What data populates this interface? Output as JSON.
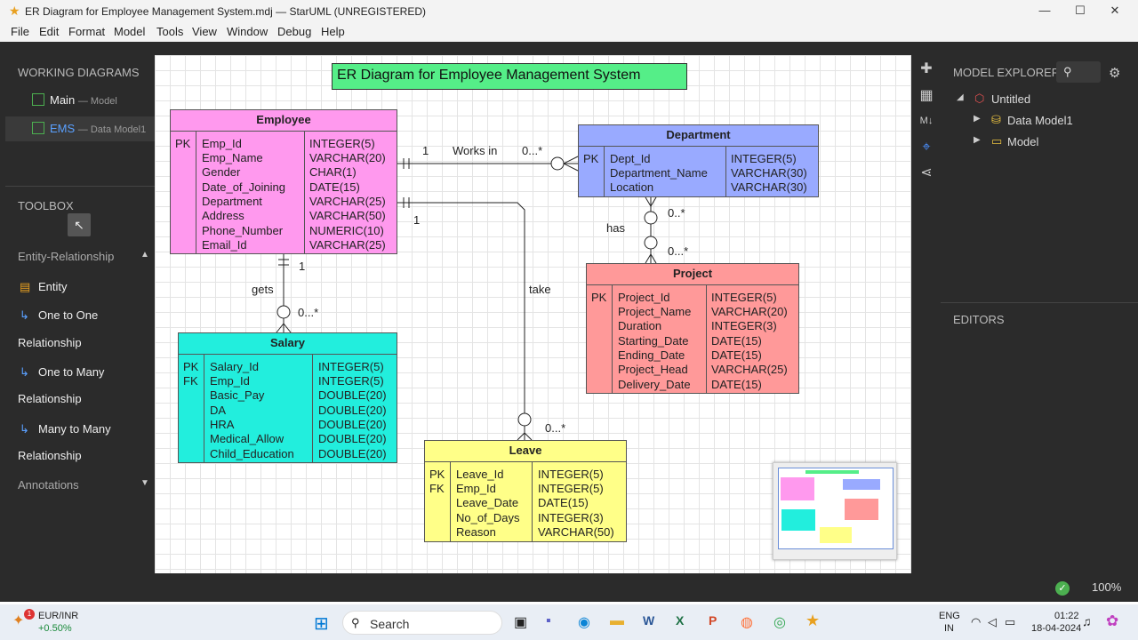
{
  "window": {
    "title": "ER Diagram for Employee Management System.mdj — StarUML (UNREGISTERED)",
    "minimize": "—",
    "maximize": "☐",
    "close": "✕"
  },
  "menu": [
    "File",
    "Edit",
    "Format",
    "Model",
    "Tools",
    "View",
    "Window",
    "Debug",
    "Help"
  ],
  "left_panel": {
    "working_diagrams_title": "WORKING DIAGRAMS",
    "diagrams": [
      {
        "name": "Main",
        "sub": "— Model"
      },
      {
        "name": "EMS",
        "sub": "— Data Model1"
      }
    ],
    "toolbox_title": "TOOLBOX",
    "section": "Entity-Relationship",
    "tools": [
      "Entity",
      "One to One",
      "Relationship",
      "One to Many",
      "Relationship",
      "Many to Many",
      "Relationship"
    ],
    "annotations": "Annotations"
  },
  "right_panel": {
    "model_explorer": "MODEL EXPLORER",
    "tree": [
      "Untitled",
      "Data Model1",
      "Model"
    ],
    "editors": "EDITORS"
  },
  "diagram": {
    "title": "ER Diagram for Employee Management System",
    "employee": {
      "name": "Employee",
      "keys": [
        "PK"
      ],
      "fields": [
        "Emp_Id",
        "Emp_Name",
        "Gender",
        "Date_of_Joining",
        "Department",
        "Address",
        "Phone_Number",
        "Email_Id"
      ],
      "types": [
        "INTEGER(5)",
        "VARCHAR(20)",
        "CHAR(1)",
        "DATE(15)",
        "VARCHAR(25)",
        "VARCHAR(50)",
        "NUMERIC(10)",
        "VARCHAR(25)"
      ]
    },
    "department": {
      "name": "Department",
      "keys": [
        "PK"
      ],
      "fields": [
        "Dept_Id",
        "Department_Name",
        "Location"
      ],
      "types": [
        "INTEGER(5)",
        "VARCHAR(30)",
        "VARCHAR(30)"
      ]
    },
    "project": {
      "name": "Project",
      "keys": [
        "PK"
      ],
      "fields": [
        "Project_Id",
        "Project_Name",
        "Duration",
        "Starting_Date",
        "Ending_Date",
        "Project_Head",
        "Delivery_Date"
      ],
      "types": [
        "INTEGER(5)",
        "VARCHAR(20)",
        "INTEGER(3)",
        "DATE(15)",
        "DATE(15)",
        "VARCHAR(25)",
        "DATE(15)"
      ]
    },
    "salary": {
      "name": "Salary",
      "keys": [
        "PK",
        "FK"
      ],
      "fields": [
        "Salary_Id",
        "Emp_Id",
        "Basic_Pay",
        "DA",
        "HRA",
        "Medical_Allow",
        "Child_Education"
      ],
      "types": [
        "INTEGER(5)",
        "INTEGER(5)",
        "DOUBLE(20)",
        "DOUBLE(20)",
        "DOUBLE(20)",
        "DOUBLE(20)",
        "DOUBLE(20)"
      ]
    },
    "leave": {
      "name": "Leave",
      "keys": [
        "PK",
        "FK"
      ],
      "fields": [
        "Leave_Id",
        "Emp_Id",
        "Leave_Date",
        "No_of_Days",
        "Reason"
      ],
      "types": [
        "INTEGER(5)",
        "INTEGER(5)",
        "DATE(15)",
        "INTEGER(3)",
        "VARCHAR(50)"
      ]
    },
    "labels": {
      "works_in": "Works in",
      "one_a": "1",
      "many_a": "0...*",
      "one_b": "1",
      "take": "take",
      "many_leave": "0...*",
      "one_c": "1",
      "gets": "gets",
      "many_salary": "0...*",
      "has": "has",
      "many_d1": "0..*",
      "many_d2": "0...*"
    }
  },
  "status": {
    "zoom": "100%"
  },
  "taskbar": {
    "stock_name": "EUR/INR",
    "stock_change": "+0.50%",
    "search": "Search",
    "lang1": "ENG",
    "lang2": "IN",
    "time": "01:22",
    "date": "18-04-2024",
    "badge": "1"
  }
}
